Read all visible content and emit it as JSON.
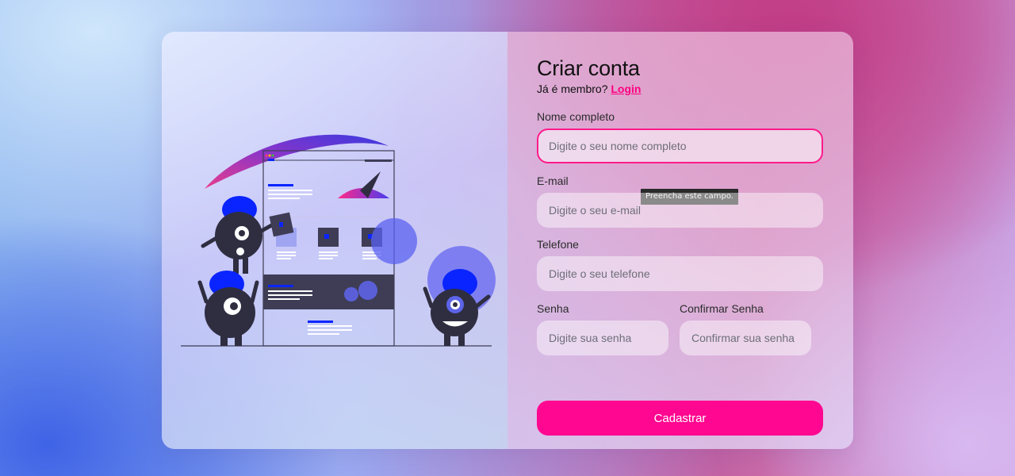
{
  "form": {
    "title": "Criar conta",
    "subtitle_prefix": "Já é membro?",
    "login_link": "Login",
    "fields": {
      "name": {
        "label": "Nome completo",
        "placeholder": "Digite o seu nome completo",
        "value": ""
      },
      "email": {
        "label": "E-mail",
        "placeholder": "Digite o seu e-mail",
        "value": ""
      },
      "phone": {
        "label": "Telefone",
        "placeholder": "Digite o seu telefone",
        "value": ""
      },
      "password": {
        "label": "Senha",
        "placeholder": "Digite sua senha",
        "value": ""
      },
      "confirm_password": {
        "label": "Confirmar Senha",
        "placeholder": "Confirmar sua senha",
        "value": ""
      }
    },
    "validation_tooltip": "Preencha este campo.",
    "submit_label": "Cadastrar"
  },
  "colors": {
    "accent": "#ff0790",
    "link": "#ff0080",
    "illustration_blue": "#0a24ff",
    "illustration_dark": "#2f2e41"
  },
  "illustration": {
    "icon": "monsters-building-website-illustration"
  }
}
